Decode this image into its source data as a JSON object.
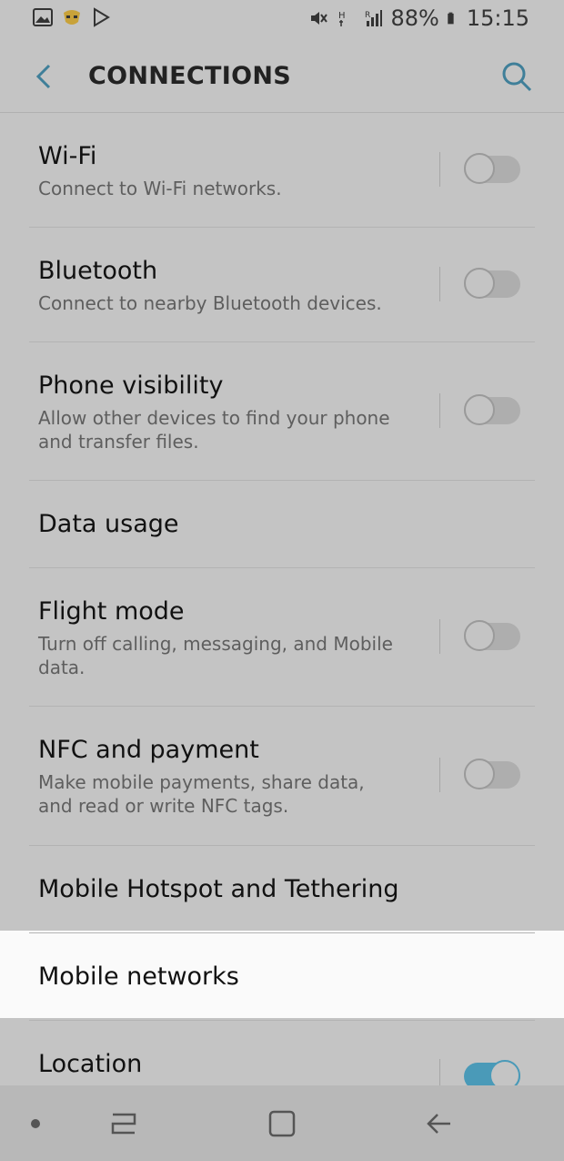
{
  "status_bar": {
    "battery": "88%",
    "time": "15:15",
    "left_icons": [
      "gallery-icon",
      "grindr-icon",
      "play-store-icon"
    ],
    "right_icons": [
      "mute-icon",
      "signal-h-icon",
      "signal-r-icon",
      "battery-icon"
    ]
  },
  "header": {
    "title": "CONNECTIONS"
  },
  "items": [
    {
      "label": "Wi-Fi",
      "desc": "Connect to Wi-Fi networks.",
      "toggle": false
    },
    {
      "label": "Bluetooth",
      "desc": "Connect to nearby Bluetooth devices.",
      "toggle": false
    },
    {
      "label": "Phone visibility",
      "desc": "Allow other devices to find your phone and transfer files.",
      "toggle": false
    },
    {
      "label": "Data usage"
    },
    {
      "label": "Flight mode",
      "desc": "Turn off calling, messaging, and Mobile data.",
      "toggle": false
    },
    {
      "label": "NFC and payment",
      "desc": "Make mobile payments, share data, and read or write NFC tags.",
      "toggle": false
    },
    {
      "label": "Mobile Hotspot and Tethering"
    },
    {
      "label": "Mobile networks"
    },
    {
      "label": "Location",
      "toggle": true
    }
  ],
  "colors": {
    "dim_background": "#c4c4c4",
    "highlight": "#fafafa",
    "accent": "#4a9ab8"
  }
}
